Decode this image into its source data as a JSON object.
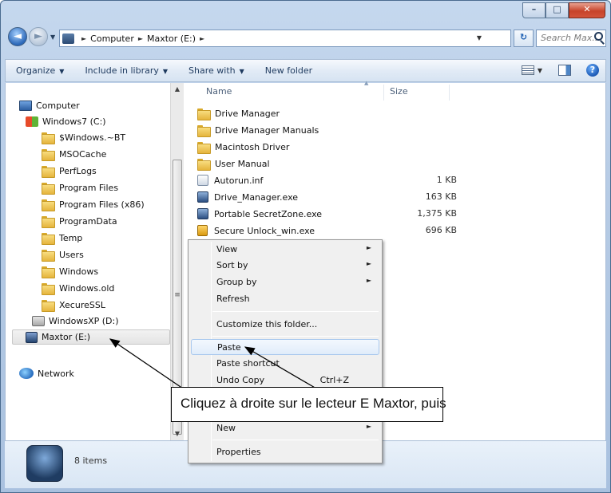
{
  "window": {
    "controls": {
      "minimize": "–",
      "maximize": "□",
      "close": "✕"
    }
  },
  "address": {
    "back_glyph": "◄",
    "forward_glyph": "►",
    "crumbs": [
      "Computer",
      "Maxtor (E:)"
    ],
    "search_placeholder": "Search Max...",
    "refresh_glyph": "↻"
  },
  "toolbar": {
    "organize": "Organize",
    "include_in_library": "Include in library",
    "share_with": "Share with",
    "new_folder": "New folder",
    "help": "?"
  },
  "nav": {
    "computer": "Computer",
    "windows7": "Windows7 (C:)",
    "folders_c": [
      "$Windows.~BT",
      "MSOCache",
      "PerfLogs",
      "Program Files",
      "Program Files (x86)",
      "ProgramData",
      "Temp",
      "Users",
      "Windows",
      "Windows.old",
      "XecureSSL"
    ],
    "windowsxp": "WindowsXP (D:)",
    "maxtor": "Maxtor (E:)",
    "network": "Network"
  },
  "content": {
    "col_name": "Name",
    "col_size": "Size",
    "files": [
      {
        "name": "Drive Manager",
        "size": "",
        "icon": "folder-icon"
      },
      {
        "name": "Drive Manager Manuals",
        "size": "",
        "icon": "folder-icon"
      },
      {
        "name": "Macintosh Driver",
        "size": "",
        "icon": "folder-icon"
      },
      {
        "name": "User Manual",
        "size": "",
        "icon": "folder-icon"
      },
      {
        "name": "Autorun.inf",
        "size": "1 KB",
        "icon": "inf-file-icon"
      },
      {
        "name": "Drive_Manager.exe",
        "size": "163 KB",
        "icon": "exe-icon"
      },
      {
        "name": "Portable SecretZone.exe",
        "size": "1,375 KB",
        "icon": "exe-icon"
      },
      {
        "name": "Secure Unlock_win.exe",
        "size": "696 KB",
        "icon": "lock-icon"
      }
    ]
  },
  "context_menu": {
    "view": "View",
    "sort_by": "Sort by",
    "group_by": "Group by",
    "refresh": "Refresh",
    "customize": "Customize this folder...",
    "paste": "Paste",
    "paste_shortcut": "Paste shortcut",
    "undo_copy": "Undo Copy",
    "undo_shortcut": "Ctrl+Z",
    "new": "New",
    "properties": "Properties"
  },
  "callout": {
    "text": "Cliquez à droite sur le lecteur E Maxtor, puis"
  },
  "details": {
    "item_count": "8 items"
  }
}
